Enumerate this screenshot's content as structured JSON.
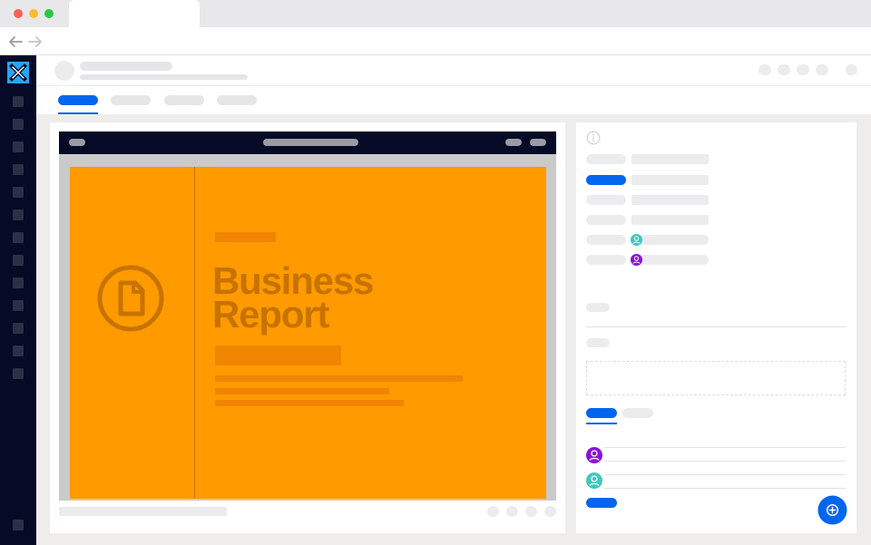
{
  "document": {
    "title": "Business\nReport"
  },
  "colors": {
    "accent": "#0066ee",
    "sidebar": "#050a26",
    "cover": "#ff9a00",
    "cover_text": "#c77300",
    "avatar_teal": "#3fc8c0",
    "avatar_purple": "#8a12d8"
  },
  "icons": {
    "logo": "x-logo-icon",
    "document": "document-icon",
    "info": "info-icon",
    "user": "user-icon",
    "fab": "plus-circle-icon"
  }
}
